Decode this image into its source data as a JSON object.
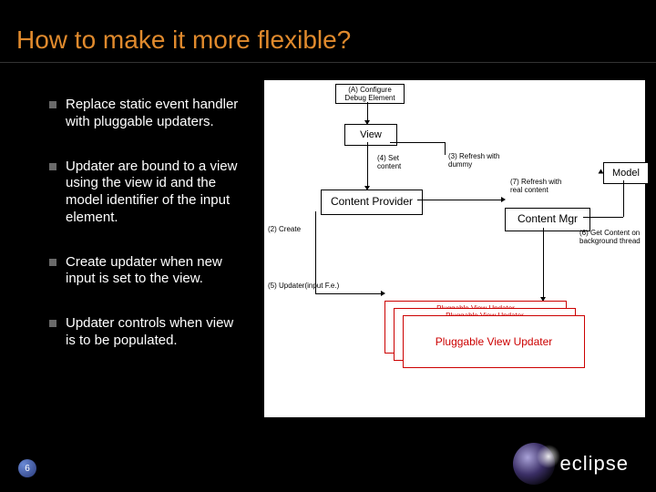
{
  "title": "How to make it more flexible?",
  "page_number": "6",
  "logo_text": "eclipse",
  "bullets": [
    "Replace static event handler with pluggable updaters.",
    "Updater are bound to a view using the view id and the model identifier of the input element.",
    "Create updater when new input is set to the view.",
    "Updater controls when view is to be populated."
  ],
  "diagram": {
    "config_input": "(A) Configure Debug Element",
    "view": "View",
    "content_provider": "Content Provider",
    "content_mgr": "Content Mgr",
    "model": "Model",
    "refresh_dummy": "(3) Refresh with dummy",
    "set_content": "(4) Set content",
    "create": "(2) Create",
    "refresh_real": "(7) Refresh with real content",
    "get_content_bg": "(6) Get Content on background thread",
    "updater_input": "(5) Updater(input F.e.)",
    "pluggable1": "Pluggable View Updater",
    "pluggable2": "Pluggable View Updater",
    "pluggable3": "Pluggable View Updater"
  }
}
